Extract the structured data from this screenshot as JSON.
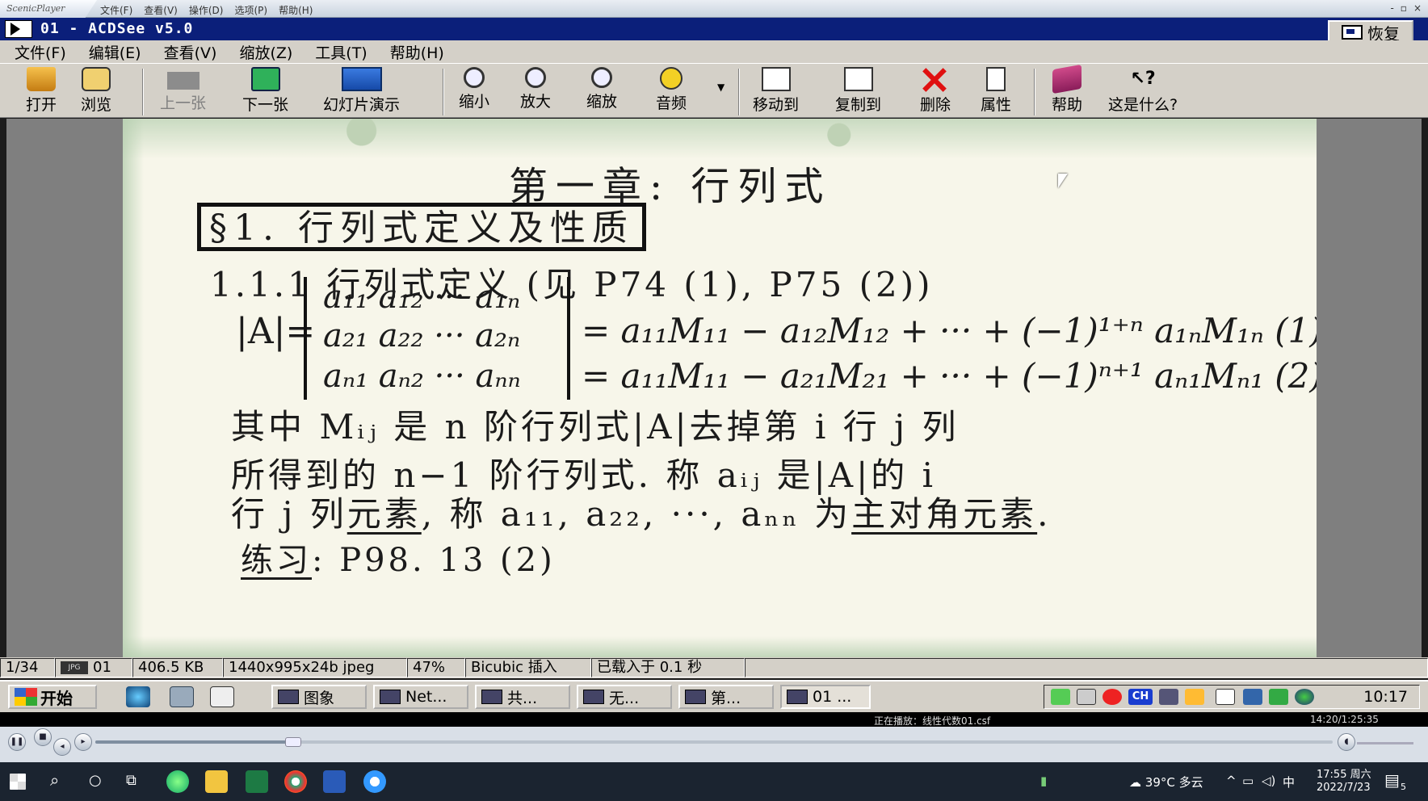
{
  "scenic": {
    "logo": "ScenicPlayer",
    "menu": [
      "文件(F)",
      "查看(V)",
      "操作(D)",
      "选项(P)",
      "帮助(H)"
    ],
    "win_buttons": [
      "-",
      "▫",
      "×"
    ]
  },
  "window": {
    "title": "01 - ACDSee v5.0",
    "restore_label": "恢复"
  },
  "menubar": [
    "文件(F)",
    "编辑(E)",
    "查看(V)",
    "缩放(Z)",
    "工具(T)",
    "帮助(H)"
  ],
  "toolbar": {
    "open": "打开",
    "browse": "浏览",
    "prev": "上一张",
    "next": "下一张",
    "slideshow": "幻灯片演示",
    "zoom_out": "缩小",
    "zoom_in": "放大",
    "zoom": "缩放",
    "audio": "音频",
    "move_to": "移动到",
    "copy_to": "复制到",
    "delete": "删除",
    "properties": "属性",
    "help": "帮助",
    "whats_this": "这是什么?"
  },
  "image": {
    "chapter": "第一章: 行列式",
    "section": "§1. 行列式定义及性质",
    "sub": "1.1.1 行列式定义 (见 P74 (1), P75 (2))",
    "det_lhs": "|A|=",
    "row1": "a₁₁ a₁₂ ··· a₁ₙ",
    "row2": "a₂₁ a₂₂ ··· a₂ₙ",
    "row3": "aₙ₁ aₙ₂ ··· aₙₙ",
    "eq1": "= a₁₁M₁₁ − a₁₂M₁₂ + ··· + (−1)¹⁺ⁿ a₁ₙM₁ₙ  (1)",
    "eq2": "= a₁₁M₁₁ − a₂₁M₂₁ + ··· + (−1)ⁿ⁺¹ aₙ₁Mₙ₁  (2)",
    "p1": "其中 Mᵢⱼ 是 n 阶行列式|A|去掉第 i 行 j 列",
    "p2": "所得到的 n−1 阶行列式. 称 aᵢⱼ 是|A|的 i",
    "p3a": "行 j 列",
    "p3b": "元素",
    "p3c": ", 称 a₁₁, a₂₂, ···, aₙₙ 为",
    "p3d": "主对角元素",
    "p3e": ".",
    "p4a": "练习",
    "p4b": ": P98. 13 (2)"
  },
  "status": {
    "index": "1/34",
    "name": "01",
    "size": "406.5 KB",
    "dims": "1440x995x24b jpeg",
    "zoom": "47%",
    "filter": "Bicubic 插入",
    "loaded": "已载入于 0.1 秒",
    "jpg_badge": "JPG"
  },
  "w98": {
    "start": "开始",
    "tasks": [
      "图象",
      "Net...",
      "共...",
      "无...",
      "第...",
      "01 ..."
    ],
    "tray_ch": "CH",
    "clock": "10:17"
  },
  "player": {
    "now_playing": "正在播放：线性代数01.csf",
    "time": "14:20/1:25:35",
    "progress": 0.16
  },
  "win10": {
    "weather": "39°C 多云",
    "ime": "中",
    "time": "17:55 周六",
    "date": "2022/7/23",
    "notif_count": "5"
  }
}
